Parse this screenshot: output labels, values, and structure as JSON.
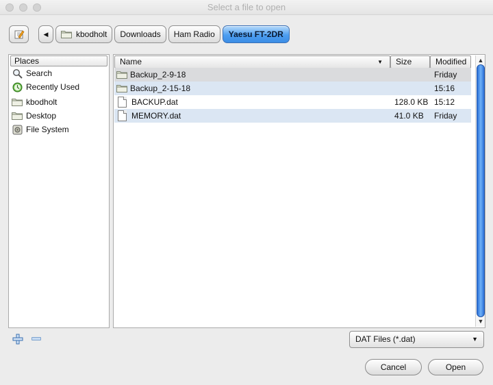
{
  "window": {
    "title": "Select a file to open"
  },
  "breadcrumb": {
    "items": [
      {
        "label": "kbodholt"
      },
      {
        "label": "Downloads"
      },
      {
        "label": "Ham Radio"
      },
      {
        "label": "Yaesu FT-2DR"
      }
    ]
  },
  "places": {
    "header": "Places",
    "items": [
      {
        "label": "Search",
        "icon": "magnifier-icon"
      },
      {
        "label": "Recently Used",
        "icon": "clock-icon"
      },
      {
        "label": "kbodholt",
        "icon": "folder-icon"
      },
      {
        "label": "Desktop",
        "icon": "folder-icon"
      },
      {
        "label": "File System",
        "icon": "drive-icon"
      }
    ]
  },
  "files": {
    "columns": {
      "name": "Name",
      "size": "Size",
      "modified": "Modified"
    },
    "rows": [
      {
        "name": "Backup_2-9-18",
        "size": "",
        "modified": "Friday",
        "type": "folder"
      },
      {
        "name": "Backup_2-15-18",
        "size": "",
        "modified": "15:16",
        "type": "folder"
      },
      {
        "name": "BACKUP.dat",
        "size": "128.0 KB",
        "modified": "15:12",
        "type": "file"
      },
      {
        "name": "MEMORY.dat",
        "size": "41.0 KB",
        "modified": "Friday",
        "type": "file"
      }
    ]
  },
  "filter": {
    "selected": "DAT Files (*.dat)"
  },
  "buttons": {
    "cancel": "Cancel",
    "open": "Open"
  },
  "colors": {
    "accent": "#4d9ef0",
    "selection": "#dadbdd",
    "alt_row": "#dbe6f3"
  }
}
